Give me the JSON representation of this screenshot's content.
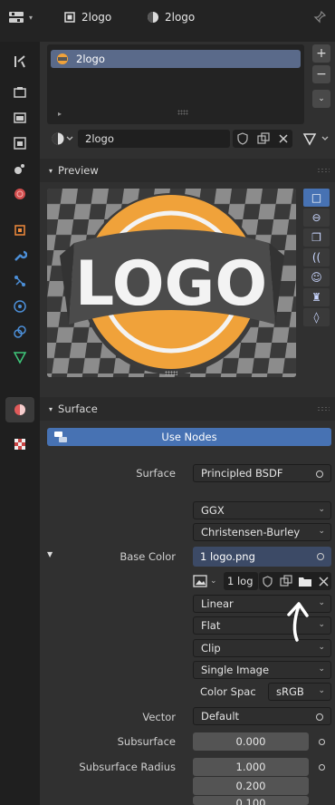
{
  "header": {
    "editor_icon": "properties-editor-icon",
    "object_name": "2logo",
    "material_name": "2logo",
    "pin_icon": "pin-icon"
  },
  "sidebar": {
    "tabs": [
      "tool",
      "render",
      "output",
      "view-layer",
      "scene",
      "world",
      "object",
      "modifiers",
      "particles",
      "physics",
      "constraints",
      "data",
      "material",
      "texture"
    ],
    "active": "material"
  },
  "material_slots": {
    "items": [
      {
        "label": "2logo"
      }
    ],
    "add_label": "+",
    "remove_label": "−"
  },
  "material_selector": {
    "name": "2logo"
  },
  "preview": {
    "title": "Preview",
    "logo_text": "LOGO"
  },
  "surface_panel": {
    "title": "Surface",
    "use_nodes_label": "Use Nodes",
    "surface_label": "Surface",
    "surface_value": "Principled BSDF",
    "distribution": "GGX",
    "subsurface_method": "Christensen-Burley",
    "base_color_label": "Base Color",
    "base_color_value": "1 logo.png",
    "image_name": "1 log",
    "interpolation": "Linear",
    "projection": "Flat",
    "extension": "Clip",
    "source": "Single Image",
    "color_space_label": "Color Spac",
    "color_space_value": "sRGB",
    "vector_label": "Vector",
    "vector_value": "Default",
    "subsurface_label": "Subsurface",
    "subsurface_value": "0.000",
    "subsurface_radius_label": "Subsurface Radius",
    "subsurface_radius": [
      "1.000",
      "0.200",
      "0.100"
    ]
  },
  "colors": {
    "accent": "#4772b3",
    "logo_orange": "#f0a23a",
    "logo_band": "#4b4b4b"
  }
}
